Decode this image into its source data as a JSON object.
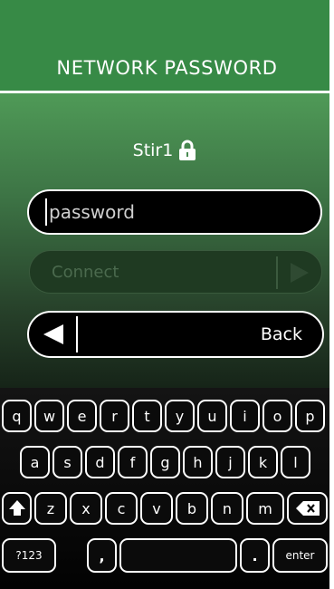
{
  "header": {
    "title": "NETWORK PASSWORD"
  },
  "network": {
    "name": "Stir1",
    "lock_icon": "lock-icon"
  },
  "password": {
    "placeholder": "password",
    "value": ""
  },
  "connect": {
    "label": "Connect",
    "enabled": false,
    "arrow_icon": "play-arrow-icon"
  },
  "back": {
    "label": "Back",
    "arrow_icon": "back-arrow-icon"
  },
  "keyboard": {
    "row1": [
      "q",
      "w",
      "e",
      "r",
      "t",
      "y",
      "u",
      "i",
      "o",
      "p"
    ],
    "row2": [
      "a",
      "s",
      "d",
      "f",
      "g",
      "h",
      "j",
      "k",
      "l"
    ],
    "row3": [
      "z",
      "x",
      "c",
      "v",
      "b",
      "n",
      "m"
    ],
    "shift_icon": "shift-icon",
    "backspace_icon": "backspace-icon",
    "symbols_label": "?123",
    "comma_label": ",",
    "space_label": "",
    "period_label": ".",
    "enter_label": "enter"
  },
  "colors": {
    "header_green": "#378a46",
    "accent_white": "#ffffff",
    "disabled_green": "#1f3a22"
  }
}
